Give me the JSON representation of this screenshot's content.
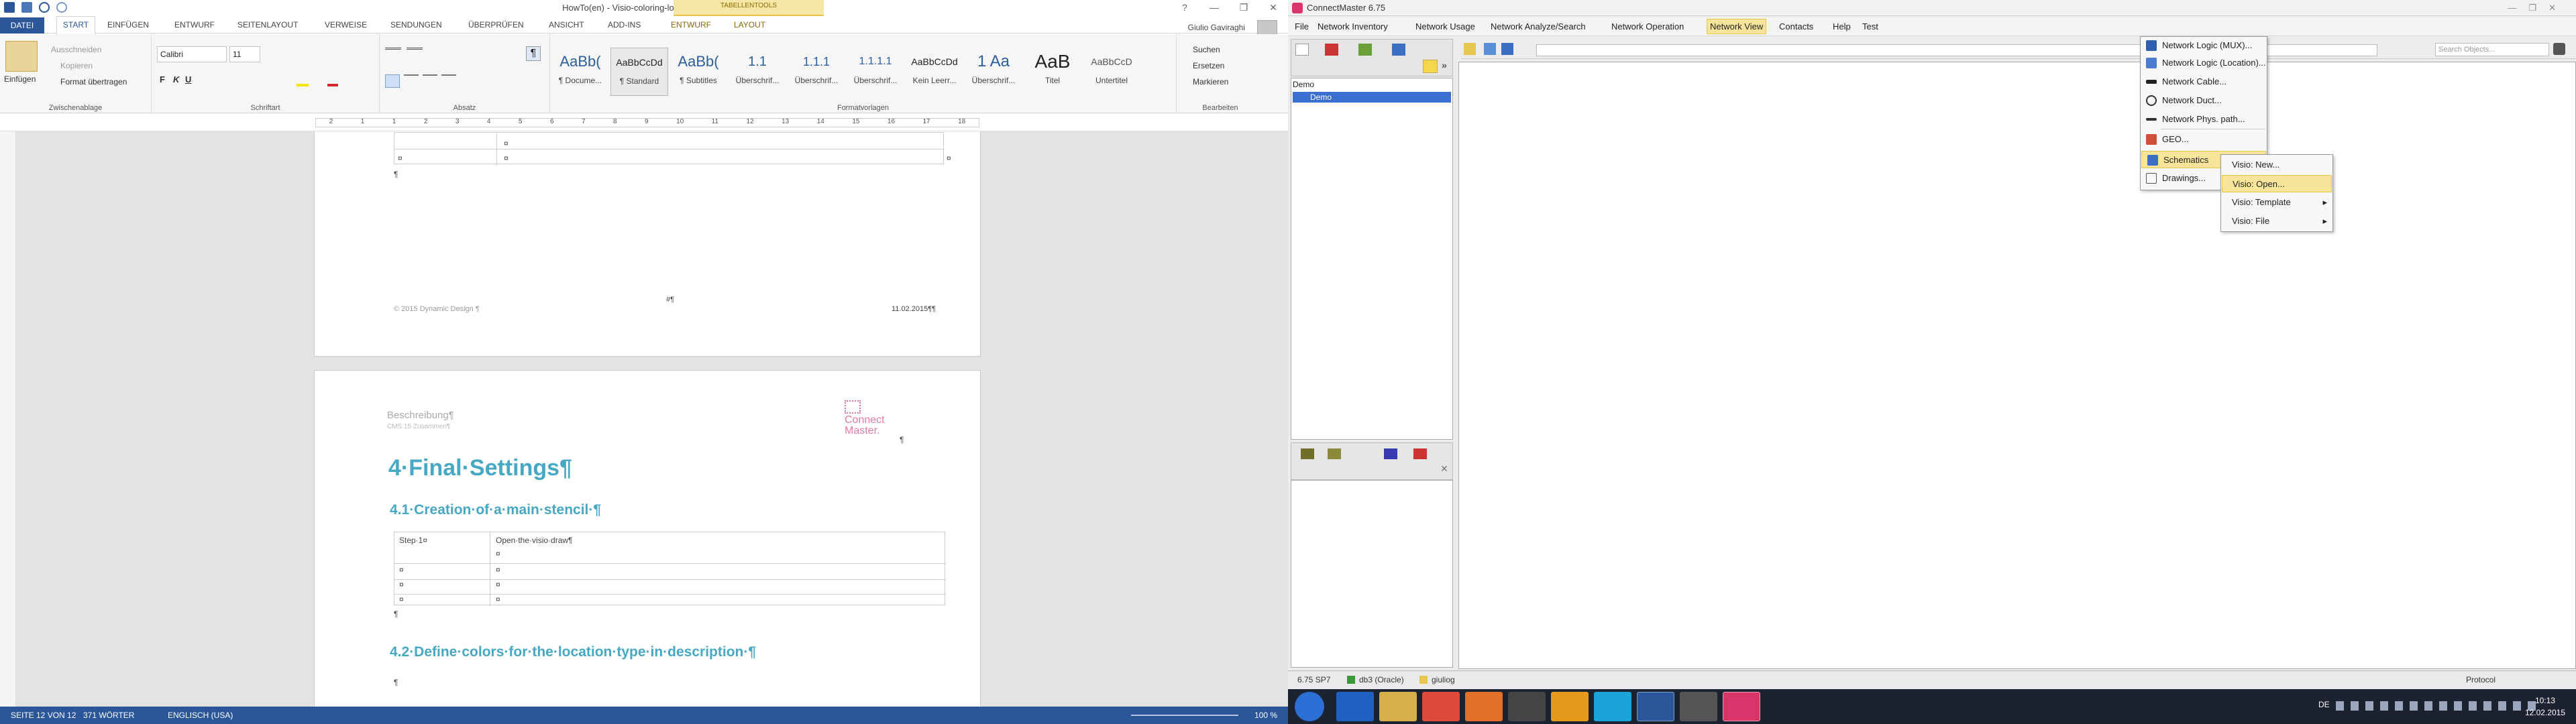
{
  "word": {
    "title": "HowTo(en) - Visio-coloring-location - Word",
    "table_tools": "TABELLENTOOLS",
    "window_buttons": [
      "?",
      "—",
      "❐",
      "✕"
    ],
    "tabs": [
      "DATEI",
      "START",
      "EINFÜGEN",
      "ENTWURF",
      "SEITENLAYOUT",
      "VERWEISE",
      "SENDUNGEN",
      "ÜBERPRÜFEN",
      "ANSICHT",
      "ADD-INS",
      "ENTWURF",
      "LAYOUT"
    ],
    "user": "Giulio Gaviraghi",
    "ribbon": {
      "paste": "Einfügen",
      "cut": "Ausschneiden",
      "copy": "Kopieren",
      "format_painter": "Format übertragen",
      "clipboard_label": "Zwischenablage",
      "font_name": "Calibri",
      "font_size": "11",
      "font_label": "Schriftart",
      "paragraph_label": "Absatz",
      "styles": [
        {
          "preview": "AaBb(",
          "name": "¶ Docume..."
        },
        {
          "preview": "AaBbCcDd",
          "name": "¶ Standard"
        },
        {
          "preview": "AaBb(",
          "name": "¶ Subtitles"
        },
        {
          "preview": "1.1",
          "name": "Überschrif..."
        },
        {
          "preview": "1.1.1",
          "name": "Überschrif..."
        },
        {
          "preview": "1.1.1.1",
          "name": "Überschrif..."
        },
        {
          "preview": "AaBbCcDd",
          "name": "Kein Leerr..."
        },
        {
          "preview": "1 Aa",
          "name": "Überschrif..."
        },
        {
          "preview": "AaB",
          "name": "Titel"
        },
        {
          "preview": "AaBbCcD",
          "name": "Untertitel"
        }
      ],
      "styles_label": "Formatvorlagen",
      "find": "Suchen",
      "replace": "Ersetzen",
      "select": "Markieren",
      "editing_label": "Bearbeiten"
    },
    "ruler_numbers": [
      "2",
      "1",
      "1",
      "2",
      "3",
      "4",
      "5",
      "6",
      "7",
      "8",
      "9",
      "10",
      "11",
      "12",
      "13",
      "14",
      "15",
      "16",
      "17",
      "18"
    ],
    "page1": {
      "footer_left": "© 2015 Dynamic Design ¶",
      "footer_center": "#¶",
      "footer_right": "11.02.2015¶¶",
      "cell_mark": "¤",
      "para_mark": "¶"
    },
    "page2": {
      "header_desc": "Beschreibung¶",
      "header_sub": "CMS 15 Zusammen¶",
      "logo_line1": "Connect",
      "logo_line2": "Master.",
      "logo_para": "¶",
      "h1": "4·Final·Settings¶",
      "h2a": "4.1·Creation·of·a·main·stencil·¶",
      "step_label": "Step·1¤",
      "step_text": "Open·the·visio·draw¶",
      "h2b": "4.2·Define·colors·for·the·location·type·in·description·¶",
      "para_mark": "¶",
      "cell_mark": "¤"
    },
    "status": {
      "page": "SEITE 12 VON 12",
      "words": "371 WÖRTER",
      "language": "ENGLISCH (USA)",
      "zoom": "100 %"
    }
  },
  "cm": {
    "title": "ConnectMaster 6.75",
    "menu": [
      "File",
      "Network Inventory",
      "Network Usage",
      "Network Analyze/Search",
      "Network Operation",
      "Network View",
      "Contacts",
      "Help",
      "Test"
    ],
    "search_placeholder": "Search Objects...",
    "tree_root": "Demo",
    "tree_item": "Demo",
    "network_view_menu": [
      "Network Logic (MUX)...",
      "Network Logic (Location)...",
      "Network Cable...",
      "Network Duct...",
      "Network Phys. path...",
      "GEO...",
      "Schematics",
      "Drawings..."
    ],
    "schematics_submenu": [
      "Visio: New...",
      "Visio: Open...",
      "Visio: Template",
      "Visio: File"
    ],
    "status": {
      "version": "6.75 SP7",
      "db": "db3 (Oracle)",
      "user": "giuliog",
      "protocol": "Protocol"
    }
  },
  "taskbar": {
    "lang": "DE",
    "time": "10:13",
    "date": "12.02.2015"
  },
  "colors": {
    "word_blue": "#2b579a",
    "heading_teal": "#46a8c2",
    "menu_highlight": "#f8e59a",
    "taskbar": "#1c2230"
  }
}
